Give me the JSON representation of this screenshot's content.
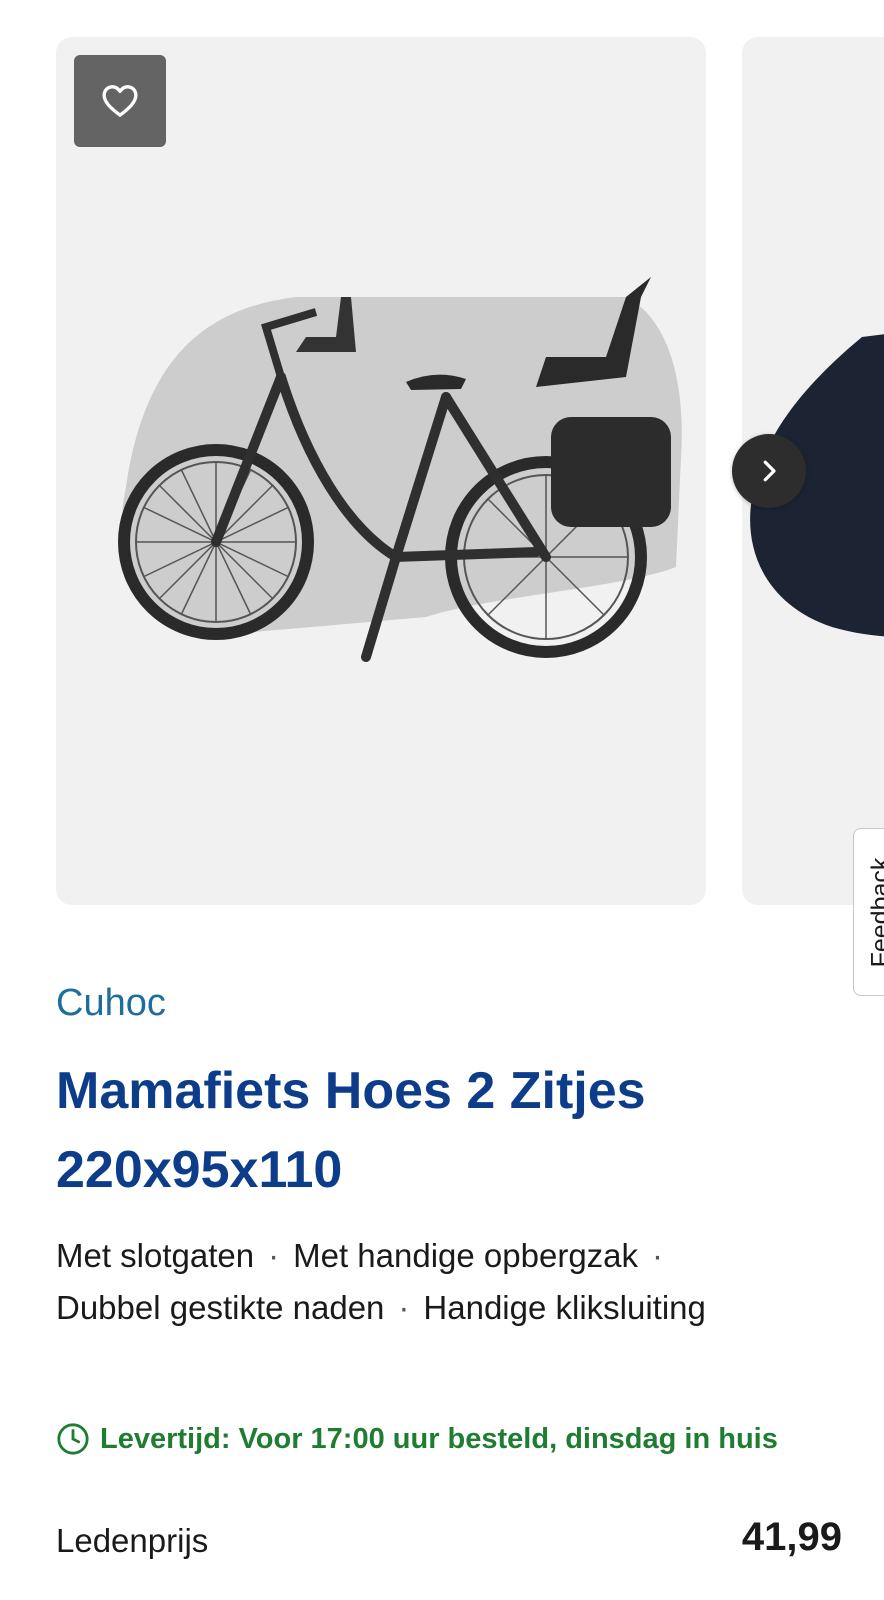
{
  "product": {
    "brand": "Cuhoc",
    "title_line1": "Mamafiets Hoes 2 Zitjes",
    "title_line2": "220x95x110",
    "features": [
      "Met slotgaten",
      "Met handige opbergzak",
      "Dubbel gestikte naden",
      "Handige kliksluiting"
    ],
    "delivery": "Levertijd: Voor 17:00 uur besteld, dinsdag in huis",
    "price_label": "Ledenprijs",
    "price": "41,99"
  },
  "feedback": {
    "label": "Feedback"
  },
  "icons": {
    "favorite": "heart-icon",
    "next": "chevron-right-icon",
    "delivery": "clock-icon"
  },
  "colors": {
    "brand": "#1e6e9b",
    "title": "#0d3d8a",
    "delivery": "#1f7d32",
    "card_background": "#f1f1f1"
  }
}
